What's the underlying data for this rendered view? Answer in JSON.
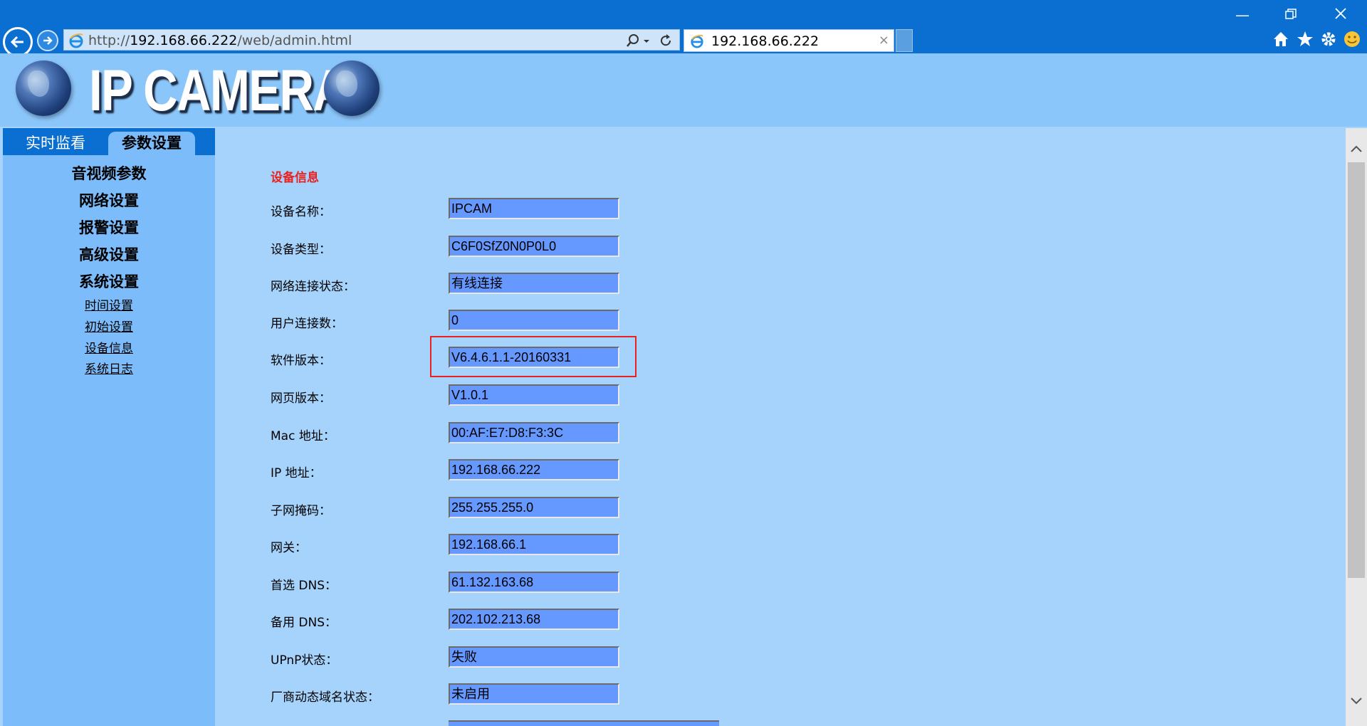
{
  "browser": {
    "url_prefix": "http://",
    "url_host": "192.168.66.222",
    "url_path": "/web/admin.html",
    "tab_title": "192.168.66.222",
    "tab_close": "×"
  },
  "banner": {
    "brand": "IP CAMERA"
  },
  "nav": {
    "tabs": [
      {
        "label": "实时监看"
      },
      {
        "label": "参数设置"
      }
    ],
    "items": [
      {
        "label": "音视频参数"
      },
      {
        "label": "网络设置"
      },
      {
        "label": "报警设置"
      },
      {
        "label": "高级设置"
      },
      {
        "label": "系统设置"
      }
    ],
    "subitems": [
      {
        "label": "时间设置"
      },
      {
        "label": "初始设置"
      },
      {
        "label": "设备信息"
      },
      {
        "label": "系统日志"
      }
    ]
  },
  "device_info": {
    "title": "设备信息",
    "fields": [
      {
        "label": "设备名称：",
        "value": "IPCAM"
      },
      {
        "label": "设备类型：",
        "value": "C6F0SfZ0N0P0L0"
      },
      {
        "label": "网络连接状态：",
        "value": "有线连接"
      },
      {
        "label": "用户连接数：",
        "value": "0"
      },
      {
        "label": "软件版本：",
        "value": "V6.4.6.1.1-20160331"
      },
      {
        "label": "网页版本：",
        "value": "V1.0.1"
      },
      {
        "label": "Mac 地址：",
        "value": "00:AF:E7:D8:F3:3C"
      },
      {
        "label": "IP 地址：",
        "value": "192.168.66.222"
      },
      {
        "label": "子网掩码：",
        "value": "255.255.255.0"
      },
      {
        "label": "网关：",
        "value": "192.168.66.1"
      },
      {
        "label": "首选 DNS：",
        "value": "61.132.163.68"
      },
      {
        "label": "备用 DNS：",
        "value": "202.102.213.68"
      },
      {
        "label": "UPnP状态：",
        "value": "失败"
      },
      {
        "label": "厂商动态域名状态：",
        "value": "未启用"
      }
    ]
  },
  "colors": {
    "chrome": "#0a6fd0",
    "banner": "#8bc6fb",
    "content_bg": "#a6d3fb",
    "nav_bg": "#7cbcfa",
    "field_bg": "#6699ff",
    "highlight": "#e8221f"
  }
}
